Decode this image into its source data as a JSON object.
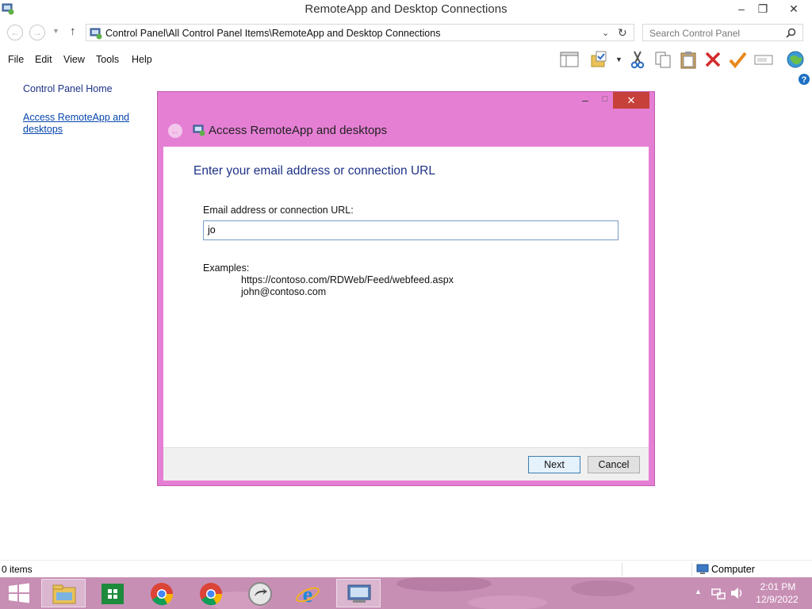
{
  "window": {
    "title": "RemoteApp and Desktop Connections",
    "minimize": "–",
    "restore": "❐",
    "close": "✕"
  },
  "address": {
    "path": "Control Panel\\All Control Panel Items\\RemoteApp and Desktop Connections",
    "search_placeholder": "Search Control Panel"
  },
  "menu": [
    "File",
    "Edit",
    "View",
    "Tools",
    "Help"
  ],
  "left_pane": {
    "home": "Control Panel Home",
    "access_link_line1": "Access RemoteApp and",
    "access_link_line2": "desktops"
  },
  "dialog": {
    "title": "Access RemoteApp and desktops",
    "heading": "Enter your email address or connection URL",
    "field_label": "Email address or connection URL:",
    "field_value": "jo",
    "examples_label": "Examples:",
    "example_1": "https://contoso.com/RDWeb/Feed/webfeed.aspx",
    "example_2": "john@contoso.com",
    "next": "Next",
    "cancel": "Cancel"
  },
  "status": {
    "items": "0 items",
    "location": "Computer"
  },
  "taskbar": {
    "time": "2:01 PM",
    "date": "12/9/2022"
  },
  "colors": {
    "dialog_frame": "#e57fd4",
    "link": "#0645ad",
    "heading": "#1e3287"
  }
}
